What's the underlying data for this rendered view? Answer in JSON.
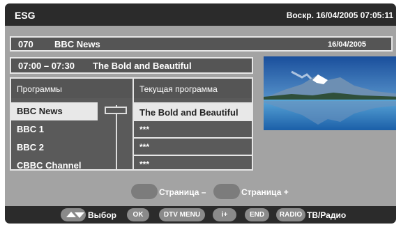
{
  "header": {
    "title": "ESG",
    "datetime": "Воскр. 16/04/2005 07:05:11"
  },
  "channel_bar": {
    "number": "070",
    "name": "BBC News",
    "date": "16/04/2005"
  },
  "program_bar": {
    "time": "07:00 – 07:30",
    "title": "The Bold and Beautiful"
  },
  "grid": {
    "col_programs": "Программы",
    "col_current": "Текущая программа",
    "rows": [
      {
        "channel": "BBC News",
        "current": "The Bold and Beautiful"
      },
      {
        "channel": "BBC 1",
        "current": "***"
      },
      {
        "channel": "BBC 2",
        "current": "***"
      },
      {
        "channel": "CBBC Channel",
        "current": "***"
      }
    ]
  },
  "pager": {
    "prev": "Страница –",
    "next": "Страница +"
  },
  "footer": {
    "select_label": "Выбор",
    "ok": "OK",
    "dtv_menu": "DTV MENU",
    "info": "i+",
    "end": "END",
    "radio": "RADIO",
    "tv_radio_label": "ТВ/Радио"
  }
}
